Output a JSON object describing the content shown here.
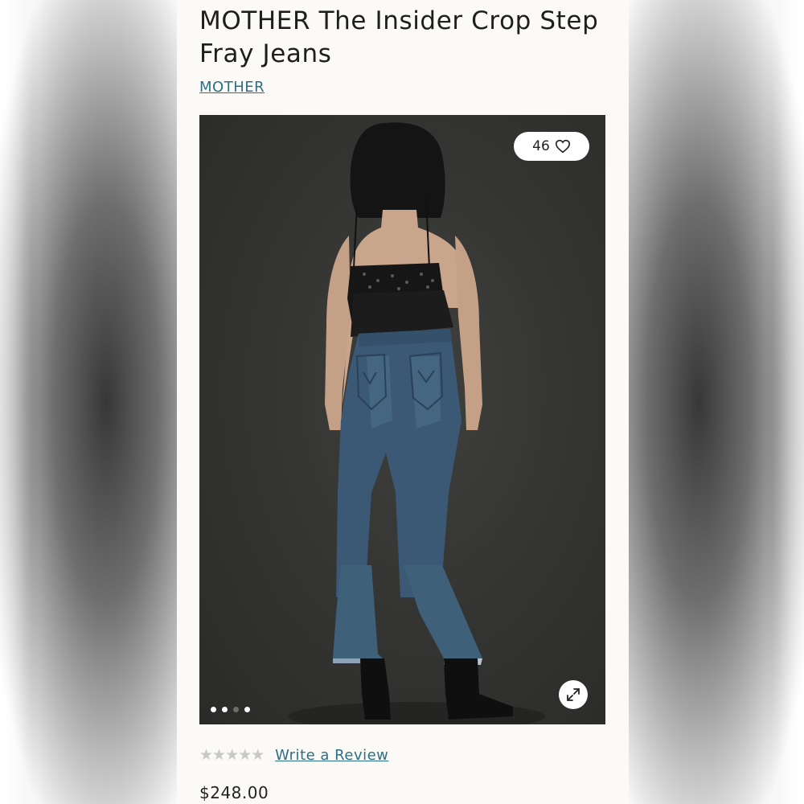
{
  "product": {
    "title": "MOTHER The Insider Crop Step Fray Jeans",
    "brand": "MOTHER",
    "price": "$248.00"
  },
  "gallery": {
    "like_count": "46",
    "like_icon": "heart-icon",
    "expand_icon": "expand-icon",
    "dots": [
      {
        "active": true
      },
      {
        "active": true
      },
      {
        "active": false
      },
      {
        "active": true
      }
    ]
  },
  "reviews": {
    "stars": "★★★★★",
    "rating_value": 0,
    "write_review_label": "Write a Review"
  },
  "colors": {
    "link": "#2d6f86",
    "page_bg": "#fbfaf6",
    "star_empty": "#c8c8c8"
  }
}
